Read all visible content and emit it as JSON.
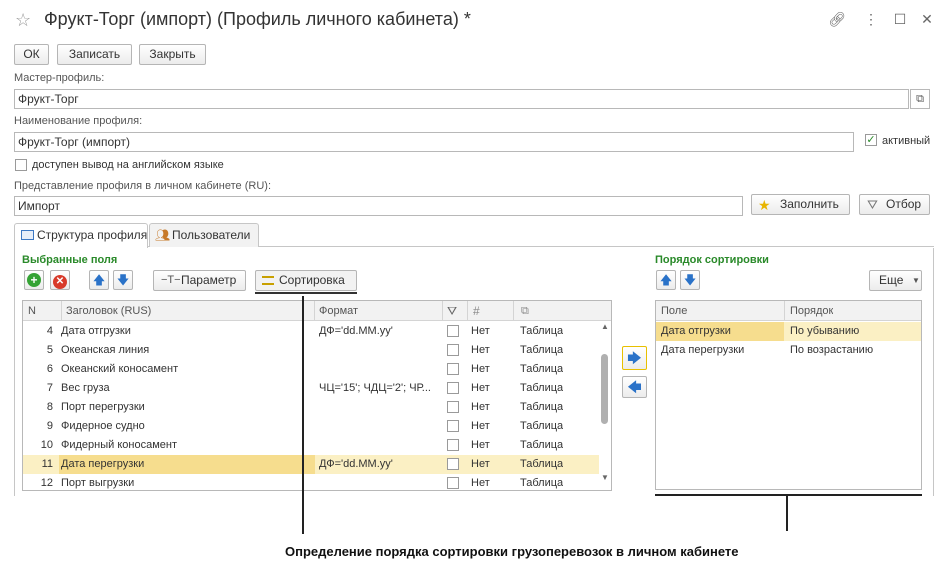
{
  "window": {
    "title": "Фрукт-Торг (импорт) (Профиль личного кабинета) *"
  },
  "toolbar": {
    "ok": "ОК",
    "save": "Записать",
    "close": "Закрыть"
  },
  "master_profile": {
    "label": "Мастер-профиль:",
    "value": "Фрукт-Торг"
  },
  "profile_name": {
    "label": "Наименование профиля:",
    "value": "Фрукт-Торг (импорт)",
    "active_label": "активный",
    "active_checked": true
  },
  "english_output": {
    "label": "доступен вывод на английском языке",
    "checked": false
  },
  "profile_view": {
    "label": "Представление профиля в личном кабинете (RU):",
    "value": "Импорт",
    "fill_button": "Заполнить",
    "filter_button": "Отбор"
  },
  "tabs": [
    {
      "label": "Структура профиля"
    },
    {
      "label": "Пользователи"
    }
  ],
  "selected_fields": {
    "title": "Выбранные поля",
    "param_button": "Параметр",
    "sort_button": "Сортировка",
    "columns": {
      "n": "N",
      "header": "Заголовок (RUS)",
      "format": "Формат"
    },
    "rows": [
      {
        "n": "4",
        "header": "Дата отгрузки",
        "format": "ДФ='dd.MM.yy'",
        "flag": "Нет",
        "type": "Таблица"
      },
      {
        "n": "5",
        "header": "Океанская линия",
        "format": "",
        "flag": "Нет",
        "type": "Таблица"
      },
      {
        "n": "6",
        "header": "Океанский коносамент",
        "format": "",
        "flag": "Нет",
        "type": "Таблица"
      },
      {
        "n": "7",
        "header": "Вес груза",
        "format": "ЧЦ='15'; ЧДЦ='2'; ЧР...",
        "flag": "Нет",
        "type": "Таблица"
      },
      {
        "n": "8",
        "header": "Порт перегрузки",
        "format": "",
        "flag": "Нет",
        "type": "Таблица"
      },
      {
        "n": "9",
        "header": "Фидерное судно",
        "format": "",
        "flag": "Нет",
        "type": "Таблица"
      },
      {
        "n": "10",
        "header": "Фидерный коносамент",
        "format": "",
        "flag": "Нет",
        "type": "Таблица"
      },
      {
        "n": "11",
        "header": "Дата перегрузки",
        "format": "ДФ='dd.MM.yy'",
        "flag": "Нет",
        "type": "Таблица"
      },
      {
        "n": "12",
        "header": "Порт выгрузки",
        "format": "",
        "flag": "Нет",
        "type": "Таблица"
      }
    ]
  },
  "sort_order": {
    "title": "Порядок сортировки",
    "more_button": "Еще",
    "columns": {
      "field": "Поле",
      "order": "Порядок"
    },
    "rows": [
      {
        "field": "Дата отгрузки",
        "order": "По убыванию"
      },
      {
        "field": "Дата перегрузки",
        "order": "По возрастанию"
      }
    ]
  },
  "caption": "Определение порядка сортировки грузоперевозок в личном кабинете",
  "icons": [
    "star-icon",
    "link-icon",
    "more-icon",
    "maximize-icon",
    "close-icon",
    "open-icon",
    "checkbox-icon",
    "fill-star-icon",
    "filter-icon",
    "structure-icon",
    "users-icon",
    "add-icon",
    "delete-icon",
    "arrow-up-icon",
    "arrow-down-icon",
    "parameter-icon",
    "sort-icon",
    "scroll-icon",
    "arrow-right-icon",
    "arrow-left-icon",
    "chevron-down-icon"
  ],
  "colors": {
    "accent_green": "#2a8a2a",
    "selection": "#fbf0c4",
    "selection_cell": "#f6dd8e",
    "blue_arrow": "#2a72c8"
  }
}
